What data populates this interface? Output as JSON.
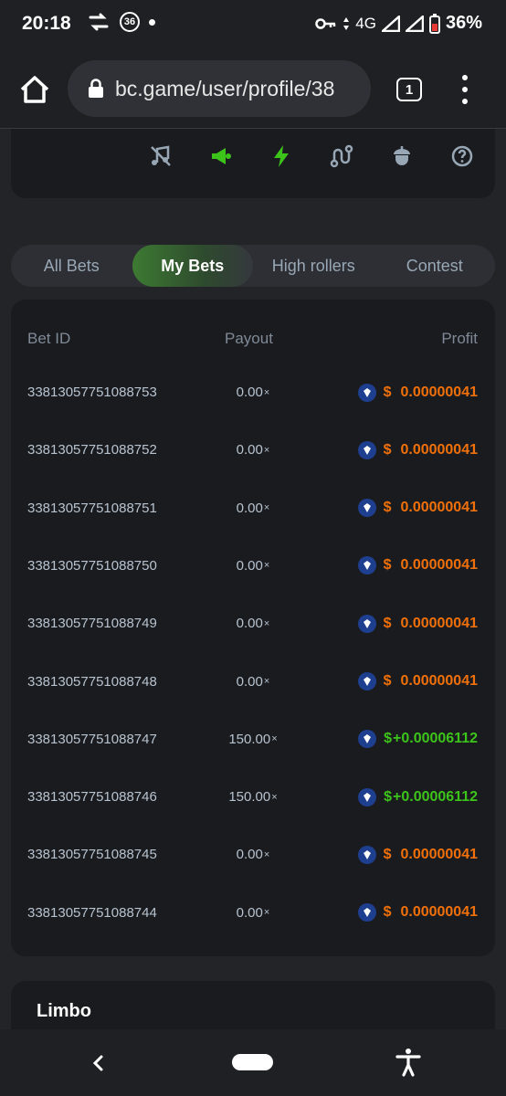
{
  "status_bar": {
    "time": "20:18",
    "badge": "36",
    "network": "4G",
    "battery": "36%"
  },
  "browser": {
    "url": "bc.game/user/profile/38",
    "tab_count": "1"
  },
  "bet_tabs": [
    {
      "label": "All Bets",
      "active": false
    },
    {
      "label": "My Bets",
      "active": true
    },
    {
      "label": "High rollers",
      "active": false
    },
    {
      "label": "Contest",
      "active": false
    }
  ],
  "table": {
    "headers": {
      "bet_id": "Bet ID",
      "payout": "Payout",
      "profit": "Profit"
    },
    "rows": [
      {
        "bet_id": "33813057751088753",
        "payout": "0.00",
        "currency": "$",
        "profit": "0.00000041",
        "win": false
      },
      {
        "bet_id": "33813057751088752",
        "payout": "0.00",
        "currency": "$",
        "profit": "0.00000041",
        "win": false
      },
      {
        "bet_id": "33813057751088751",
        "payout": "0.00",
        "currency": "$",
        "profit": "0.00000041",
        "win": false
      },
      {
        "bet_id": "33813057751088750",
        "payout": "0.00",
        "currency": "$",
        "profit": "0.00000041",
        "win": false
      },
      {
        "bet_id": "33813057751088749",
        "payout": "0.00",
        "currency": "$",
        "profit": "0.00000041",
        "win": false
      },
      {
        "bet_id": "33813057751088748",
        "payout": "0.00",
        "currency": "$",
        "profit": "0.00000041",
        "win": false
      },
      {
        "bet_id": "33813057751088747",
        "payout": "150.00",
        "currency": "$",
        "profit": "+0.00006112",
        "win": true
      },
      {
        "bet_id": "33813057751088746",
        "payout": "150.00",
        "currency": "$",
        "profit": "+0.00006112",
        "win": true
      },
      {
        "bet_id": "33813057751088745",
        "payout": "0.00",
        "currency": "$",
        "profit": "0.00000041",
        "win": false
      },
      {
        "bet_id": "33813057751088744",
        "payout": "0.00",
        "currency": "$",
        "profit": "0.00000041",
        "win": false
      }
    ],
    "payout_suffix": "×"
  },
  "game_section": {
    "title": "Limbo"
  },
  "colors": {
    "win": "#3dc41b",
    "loss": "#f0700a",
    "accent": "#3dc41b"
  },
  "game_icons": [
    "music-off-icon",
    "horn-icon",
    "lightning-icon",
    "route-icon",
    "acorn-icon",
    "help-icon"
  ]
}
